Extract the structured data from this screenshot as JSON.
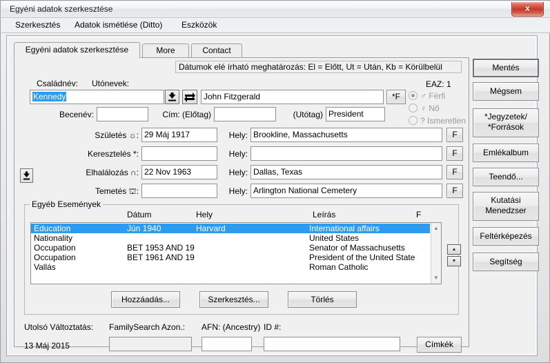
{
  "window": {
    "title": "Egyéni adatok szerkesztése",
    "close_label": "x"
  },
  "menubar": {
    "items": [
      {
        "label": "Szerkesztés",
        "accel": "S"
      },
      {
        "label": "Adatok ismétlése (Ditto)",
        "accel": "A"
      },
      {
        "label": "Eszközök",
        "accel": "E"
      }
    ]
  },
  "tabs": [
    {
      "label": "Egyéni adatok szerkesztése",
      "active": true
    },
    {
      "label": "More",
      "active": false
    },
    {
      "label": "Contact",
      "active": false
    }
  ],
  "hint": {
    "text": "Dátumok elé írható meghatározás: El = Előtt, Ut = Után, Kb = Körülbelül"
  },
  "names": {
    "surname_label": "Családnév:",
    "surname_value": "Kennedy",
    "given_label": "Utónevek:",
    "given_value": "John Fitzgerald",
    "eaz_label": "EAZ: 1",
    "f_button": "*F",
    "nickname_label": "Becenév:",
    "nickname_value": "",
    "title_prefix_label": "Cím: (Előtag)",
    "title_prefix_value": "",
    "title_suffix_label": "(Utótag)",
    "title_suffix_value": "President",
    "dropdown_icon": "down-arrow-bar-icon",
    "swap_icon": "swap-arrows-icon"
  },
  "gender": {
    "options": [
      {
        "label": "♂ Férfi",
        "selected": true
      },
      {
        "label": "♀ Nő",
        "selected": false
      },
      {
        "label": "? Ismeretlen",
        "selected": false
      }
    ]
  },
  "events": {
    "place_label": "Hely:",
    "f_label": "F",
    "rows": [
      {
        "label": "Születés ☼:",
        "date": "29 Máj 1917",
        "place": "Brookline, Massachusetts"
      },
      {
        "label": "Keresztelés *:",
        "date": "",
        "place": ""
      },
      {
        "label": "Elhalálozás ∩:",
        "date": "22 Nov 1963",
        "place": "Dallas, Texas"
      },
      {
        "label": "Temetés ⛫:",
        "date": "",
        "place": "Arlington National Cemetery"
      }
    ]
  },
  "other_events": {
    "group_title": "Egyéb Események",
    "columns": [
      "",
      "Dátum",
      "Hely",
      "Leírás",
      "F"
    ],
    "rows": [
      {
        "type": "Education",
        "date": "Jún 1940",
        "place": "Harvard",
        "desc": "International affairs",
        "f": "",
        "selected": true
      },
      {
        "type": "Nationality",
        "date": "",
        "place": "",
        "desc": "United States",
        "f": "",
        "selected": false
      },
      {
        "type": "Occupation",
        "date": "BET 1953 AND 19",
        "place": "",
        "desc": "Senator of Massachusetts",
        "f": "",
        "selected": false
      },
      {
        "type": "Occupation",
        "date": "BET 1961 AND 19",
        "place": "",
        "desc": "President of the United State",
        "f": "",
        "selected": false
      },
      {
        "type": "Vallás",
        "date": "",
        "place": "",
        "desc": "Roman Catholic",
        "f": "",
        "selected": false
      }
    ],
    "buttons": [
      {
        "label": "Hozzáadás..."
      },
      {
        "label": "Szerkesztés..."
      },
      {
        "label": "Törlés"
      }
    ],
    "spin_up": "▲",
    "spin_down": "▼"
  },
  "footer": {
    "last_change_label": "Utolsó Változtatás:",
    "last_change_value": "13 Máj 2015",
    "familysearch_label": "FamilySearch Azon.:",
    "familysearch_value": "",
    "afn_label": "AFN: (Ancestry)",
    "afn_value": "",
    "id_label": "ID #:",
    "id_value": "",
    "tags_button": "Címkék"
  },
  "sidebar": {
    "buttons": [
      {
        "label": "Mentés",
        "default": true
      },
      {
        "label": "Mégsem",
        "default": false
      },
      {
        "label": "*Jegyzetek/\n*Források",
        "line1": "*Jegyzetek/",
        "line2": "*Források",
        "default": false
      },
      {
        "label": "Emlékalbum",
        "default": false
      },
      {
        "label": "Teendő...",
        "default": false
      },
      {
        "label": "Kutatási\nMenedzser",
        "line1": "Kutatási",
        "line2": "Menedzser",
        "default": false
      },
      {
        "label": "Feltérképezés",
        "default": false
      },
      {
        "label": "Segítség",
        "default": false
      }
    ]
  },
  "colors": {
    "selection": "#2d9cf0",
    "window_bg": "#f0f0f0",
    "close_red": "#c33828"
  }
}
